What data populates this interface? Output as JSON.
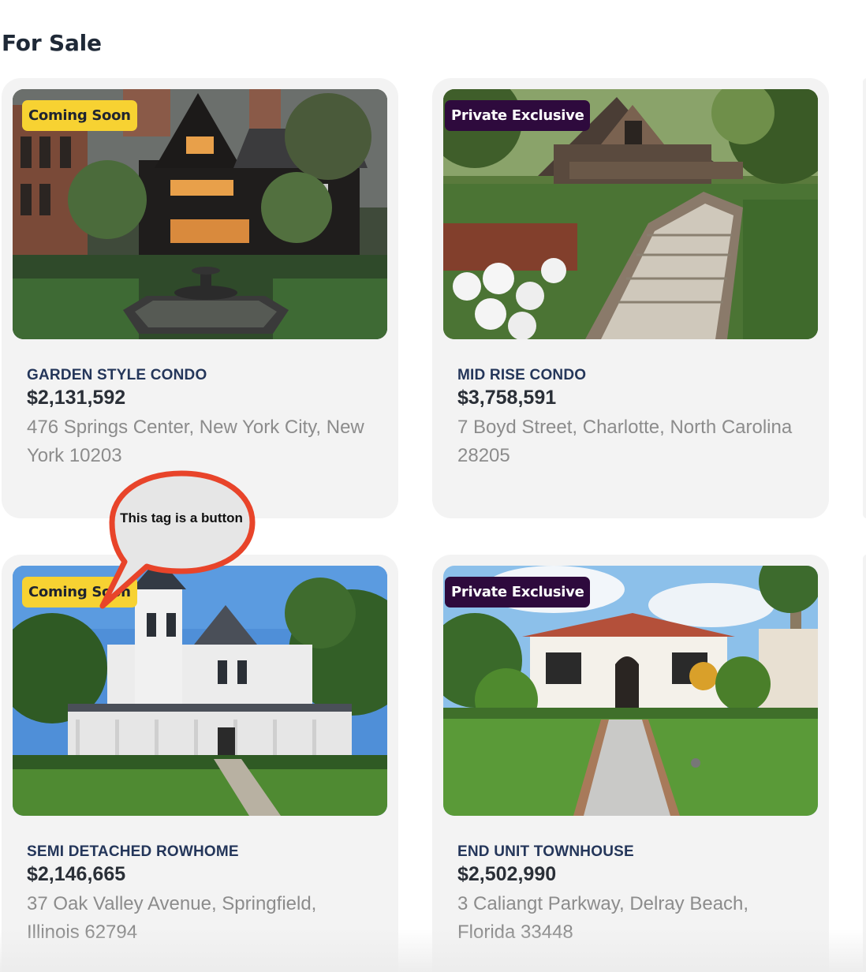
{
  "section": {
    "title": "For Sale"
  },
  "listings": [
    {
      "tag": "Coming Soon",
      "tag_style": "coming-soon",
      "type": "GARDEN STYLE CONDO",
      "price": "$2,131,592",
      "address": "476 Springs Center, New York City, New York 10203",
      "photo_icon": "tudor-house-garden-fountain-photo"
    },
    {
      "tag": "Private Exclusive",
      "tag_style": "private-exclusive",
      "type": "MID RISE CONDO",
      "price": "$3,758,591",
      "address": "7 Boyd Street, Charlotte, North Carolina 28205",
      "photo_icon": "stone-cottage-garden-steps-photo"
    },
    {
      "tag": "Coming Soon",
      "tag_style": "coming-soon",
      "type": "SEMI DETACHED ROWHOME",
      "price": "$2,146,665",
      "address": "37 Oak Valley Avenue, Springfield, Illinois 62794",
      "photo_icon": "victorian-house-porch-photo"
    },
    {
      "tag": "Private Exclusive",
      "tag_style": "private-exclusive",
      "type": "END UNIT TOWNHOUSE",
      "price": "$2,502,990",
      "address": "3 Caliangt Parkway, Delray Beach, Florida 33448",
      "photo_icon": "spanish-bungalow-lawn-photo"
    }
  ],
  "annotation": {
    "text": "This tag is a button",
    "color": "#e8442a",
    "fill": "#e6e6e6"
  },
  "colors": {
    "coming_soon_bg": "#f7d232",
    "private_exclusive_bg": "#2e0a3d",
    "card_bg": "#f3f3f3",
    "type_text": "#24365a"
  }
}
